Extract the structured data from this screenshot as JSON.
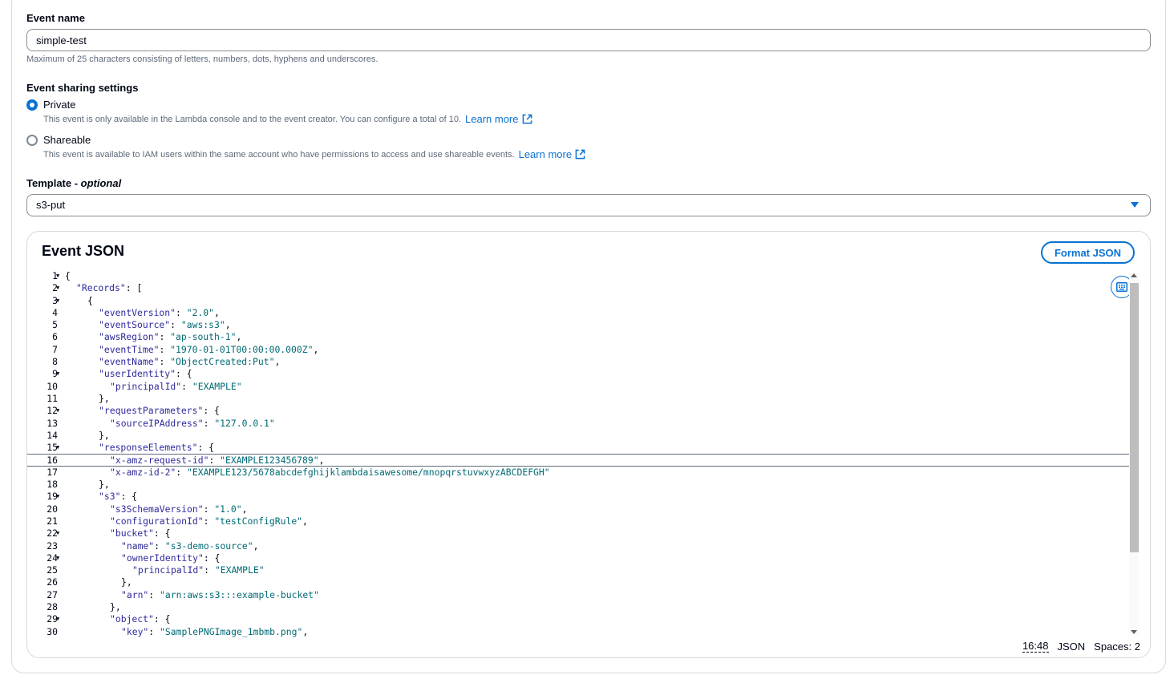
{
  "event_name": {
    "label": "Event name",
    "value": "simple-test",
    "hint": "Maximum of 25 characters consisting of letters, numbers, dots, hyphens and underscores."
  },
  "sharing": {
    "label": "Event sharing settings",
    "private_label": "Private",
    "private_desc": "This event is only available in the Lambda console and to the event creator. You can configure a total of 10.",
    "shareable_label": "Shareable",
    "shareable_desc": "This event is available to IAM users within the same account who have permissions to access and use shareable events.",
    "learn_more": "Learn more",
    "selected": "Private"
  },
  "template": {
    "label": "Template - ",
    "optional": "optional",
    "value": "s3-put"
  },
  "editor": {
    "title": "Event JSON",
    "format_button": "Format JSON",
    "active_line": 16,
    "status_cursor": "16:48",
    "status_mode": "JSON",
    "status_spaces": "Spaces: 2",
    "lines": [
      {
        "n": "1",
        "fold": true,
        "indent": 0,
        "key": "",
        "val": "",
        "tail": "{"
      },
      {
        "n": "2",
        "fold": true,
        "indent": 1,
        "key": "\"Records\"",
        "val": "",
        "tail": ": ["
      },
      {
        "n": "3",
        "fold": true,
        "indent": 2,
        "key": "",
        "val": "",
        "tail": "{"
      },
      {
        "n": "4",
        "fold": false,
        "indent": 3,
        "key": "\"eventVersion\"",
        "val": "\"2.0\"",
        "tail": ","
      },
      {
        "n": "5",
        "fold": false,
        "indent": 3,
        "key": "\"eventSource\"",
        "val": "\"aws:s3\"",
        "tail": ","
      },
      {
        "n": "6",
        "fold": false,
        "indent": 3,
        "key": "\"awsRegion\"",
        "val": "\"ap-south-1\"",
        "tail": ","
      },
      {
        "n": "7",
        "fold": false,
        "indent": 3,
        "key": "\"eventTime\"",
        "val": "\"1970-01-01T00:00:00.000Z\"",
        "tail": ","
      },
      {
        "n": "8",
        "fold": false,
        "indent": 3,
        "key": "\"eventName\"",
        "val": "\"ObjectCreated:Put\"",
        "tail": ","
      },
      {
        "n": "9",
        "fold": true,
        "indent": 3,
        "key": "\"userIdentity\"",
        "val": "",
        "tail": ": {"
      },
      {
        "n": "10",
        "fold": false,
        "indent": 4,
        "key": "\"principalId\"",
        "val": "\"EXAMPLE\"",
        "tail": ""
      },
      {
        "n": "11",
        "fold": false,
        "indent": 3,
        "key": "",
        "val": "",
        "tail": "},"
      },
      {
        "n": "12",
        "fold": true,
        "indent": 3,
        "key": "\"requestParameters\"",
        "val": "",
        "tail": ": {"
      },
      {
        "n": "13",
        "fold": false,
        "indent": 4,
        "key": "\"sourceIPAddress\"",
        "val": "\"127.0.0.1\"",
        "tail": ""
      },
      {
        "n": "14",
        "fold": false,
        "indent": 3,
        "key": "",
        "val": "",
        "tail": "},"
      },
      {
        "n": "15",
        "fold": true,
        "indent": 3,
        "key": "\"responseElements\"",
        "val": "",
        "tail": ": {"
      },
      {
        "n": "16",
        "fold": false,
        "indent": 4,
        "key": "\"x-amz-request-id\"",
        "val": "\"EXAMPLE123456789\"",
        "tail": ","
      },
      {
        "n": "17",
        "fold": false,
        "indent": 4,
        "key": "\"x-amz-id-2\"",
        "val": "\"EXAMPLE123/5678abcdefghijklambdaisawesome/mnopqrstuvwxyzABCDEFGH\"",
        "tail": ""
      },
      {
        "n": "18",
        "fold": false,
        "indent": 3,
        "key": "",
        "val": "",
        "tail": "},"
      },
      {
        "n": "19",
        "fold": true,
        "indent": 3,
        "key": "\"s3\"",
        "val": "",
        "tail": ": {"
      },
      {
        "n": "20",
        "fold": false,
        "indent": 4,
        "key": "\"s3SchemaVersion\"",
        "val": "\"1.0\"",
        "tail": ","
      },
      {
        "n": "21",
        "fold": false,
        "indent": 4,
        "key": "\"configurationId\"",
        "val": "\"testConfigRule\"",
        "tail": ","
      },
      {
        "n": "22",
        "fold": true,
        "indent": 4,
        "key": "\"bucket\"",
        "val": "",
        "tail": ": {"
      },
      {
        "n": "23",
        "fold": false,
        "indent": 5,
        "key": "\"name\"",
        "val": "\"s3-demo-source\"",
        "tail": ","
      },
      {
        "n": "24",
        "fold": true,
        "indent": 5,
        "key": "\"ownerIdentity\"",
        "val": "",
        "tail": ": {"
      },
      {
        "n": "25",
        "fold": false,
        "indent": 6,
        "key": "\"principalId\"",
        "val": "\"EXAMPLE\"",
        "tail": ""
      },
      {
        "n": "26",
        "fold": false,
        "indent": 5,
        "key": "",
        "val": "",
        "tail": "},"
      },
      {
        "n": "27",
        "fold": false,
        "indent": 5,
        "key": "\"arn\"",
        "val": "\"arn:aws:s3:::example-bucket\"",
        "tail": ""
      },
      {
        "n": "28",
        "fold": false,
        "indent": 4,
        "key": "",
        "val": "",
        "tail": "},"
      },
      {
        "n": "29",
        "fold": true,
        "indent": 4,
        "key": "\"object\"",
        "val": "",
        "tail": ": {"
      },
      {
        "n": "30",
        "fold": false,
        "indent": 5,
        "key": "\"key\"",
        "val": "\"SamplePNGImage_1mbmb.png\"",
        "tail": ","
      }
    ]
  },
  "icons": {
    "external_link": "external-link-icon",
    "settings": "keyboard-settings-icon",
    "dropdown": "caret-down-icon"
  },
  "colors": {
    "accent": "#0972d3",
    "key": "#2e2a9c",
    "string": "#006b75",
    "text": "#000716",
    "muted": "#5f6b7a"
  }
}
